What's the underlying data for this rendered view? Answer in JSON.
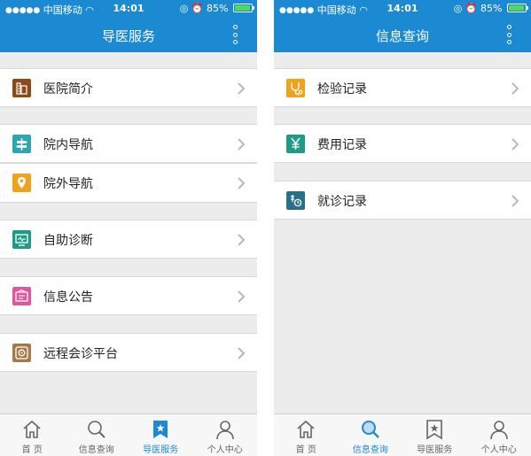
{
  "colors": {
    "accent": "#1c8ad2",
    "background": "#ececec",
    "chevron": "#b8b8b8"
  },
  "status_bar": {
    "carrier": "中国移动",
    "time": "14:01",
    "battery": "85%",
    "battery_level": 0.85
  },
  "left": {
    "title": "导医服务",
    "items": [
      {
        "label": "医院简介",
        "icon": "building-icon",
        "color": "#8b4a18"
      },
      {
        "label": "院内导航",
        "icon": "signpost-icon",
        "color": "#2aa6b5"
      },
      {
        "label": "院外导航",
        "icon": "map-pin-icon",
        "color": "#f2a11c"
      },
      {
        "label": "自助诊断",
        "icon": "monitor-icon",
        "color": "#1f9a86"
      },
      {
        "label": "信息公告",
        "icon": "notice-icon",
        "color": "#e2569a"
      },
      {
        "label": "远程会诊平台",
        "icon": "remote-icon",
        "color": "#a57a46"
      }
    ]
  },
  "right": {
    "title": "信息查询",
    "items": [
      {
        "label": "检验记录",
        "icon": "stethoscope-icon",
        "color": "#f2a11c"
      },
      {
        "label": "费用记录",
        "icon": "yen-icon",
        "color": "#1f9a86"
      },
      {
        "label": "就诊记录",
        "icon": "visit-record-icon",
        "color": "#2a6f86"
      }
    ]
  },
  "tabbar": {
    "tabs": [
      {
        "label": "首  页",
        "icon": "home-icon"
      },
      {
        "label": "信息查询",
        "icon": "search-icon"
      },
      {
        "label": "导医服务",
        "icon": "bookmark-star-icon"
      },
      {
        "label": "个人中心",
        "icon": "person-icon"
      }
    ]
  }
}
